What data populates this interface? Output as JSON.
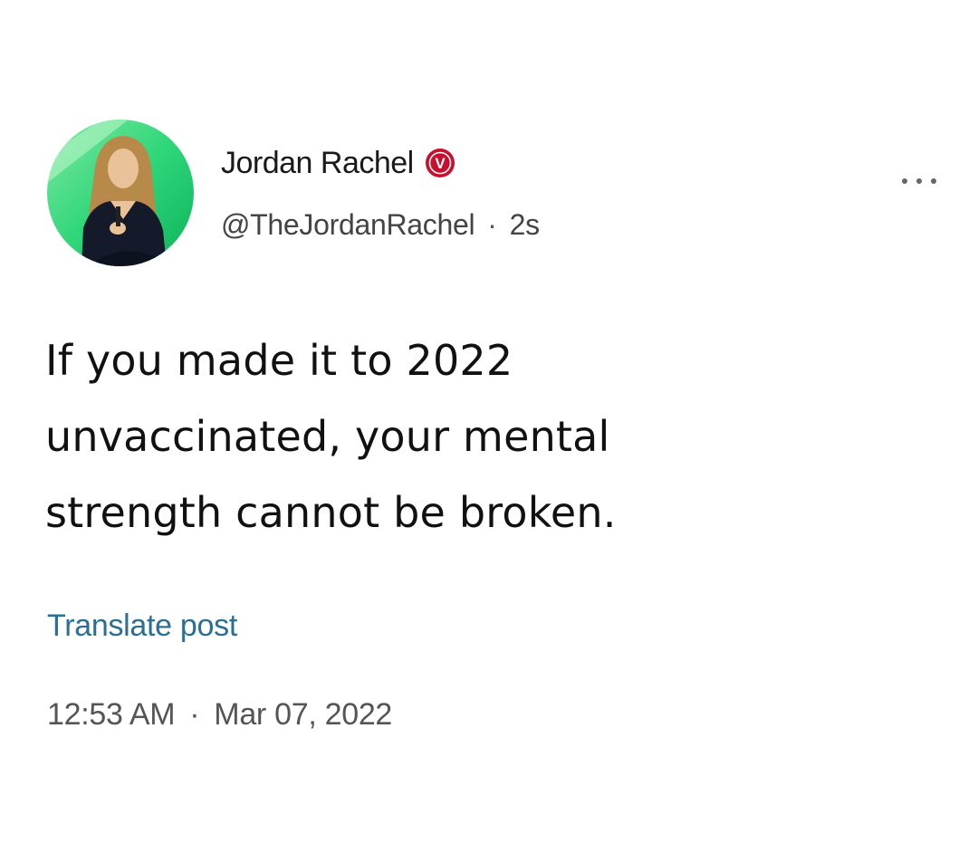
{
  "post": {
    "author": {
      "display_name": "Jordan Rachel",
      "handle": "@TheJordanRachel",
      "verified_badge_letter": "V",
      "avatar_icon": "profile-photo"
    },
    "relative_time": "2s",
    "separator": "·",
    "more_icon": "more-horizontal-icon",
    "text_lines": [
      "If you made it to 2022",
      "unvaccinated, your mental",
      "strength cannot be broken."
    ],
    "translate_label": "Translate post",
    "time": "12:53 AM",
    "date": "Mar 07, 2022"
  },
  "colors": {
    "badge": "#c8102e",
    "link": "#2a6f95",
    "text": "#111111",
    "secondary_text": "#555555",
    "avatar_background": "#2ecc71"
  }
}
